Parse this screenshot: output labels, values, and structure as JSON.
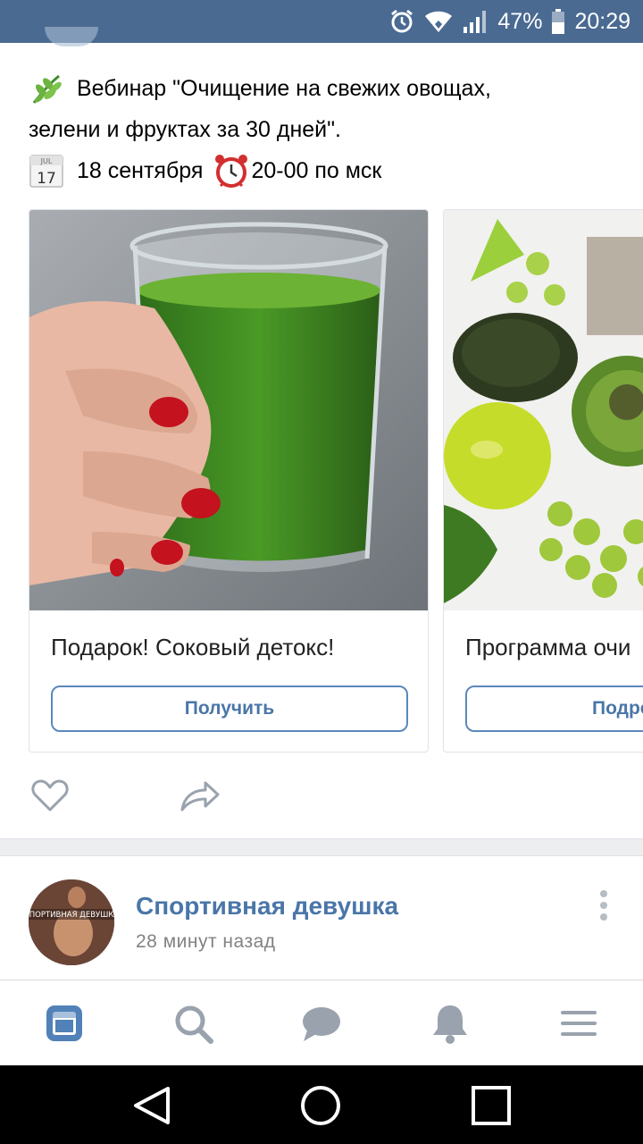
{
  "status_bar": {
    "battery": "47%",
    "time": "20:29",
    "icons": [
      "alarm-icon",
      "wifi-icon",
      "signal-icon",
      "battery-icon"
    ]
  },
  "post": {
    "line1": "Вебинар \"Очищение на свежих овощах,",
    "line2": "зелени и фруктах за 30 дней\".",
    "date": "18 сентября",
    "calendar_month": "JUL",
    "calendar_day": "17",
    "time": "20-00 по мск"
  },
  "carousel": [
    {
      "title": "Подарок! Соковый детокс!",
      "button": "Получить"
    },
    {
      "title": "Программа очи",
      "button": "Подро"
    }
  ],
  "next_post": {
    "author": "Спортивная девушка",
    "time": "28 минут назад",
    "avatar_text": "СПОРТИВНАЯ ДЕВУШКА"
  },
  "tab_bar": [
    "news-icon",
    "search-icon",
    "messages-icon",
    "notifications-icon",
    "menu-icon"
  ],
  "colors": {
    "accent": "#4a76a8",
    "status_bar": "#4a6a92"
  }
}
